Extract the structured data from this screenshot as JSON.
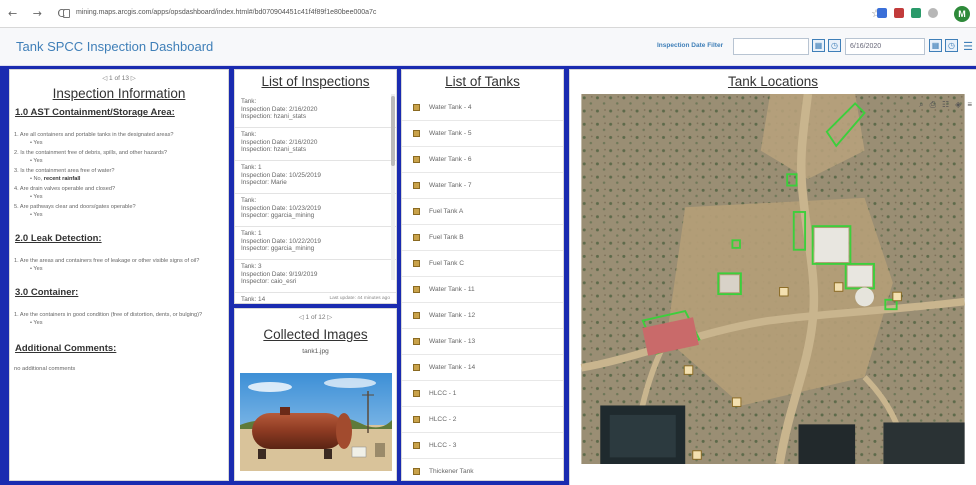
{
  "browser": {
    "nav": "← → C",
    "url": "mining.maps.arcgis.com/apps/opsdashboard/index.html#/bd070904451c41f4f89f1e80bee000a7c",
    "avatar": "M"
  },
  "header": {
    "title": "Tank SPCC Inspection Dashboard",
    "filter_label": "Inspection Date Filter",
    "date_to": "6/16/2020"
  },
  "info_panel": {
    "pager": "◁   1 of 13   ▷",
    "heading": "Inspection Information",
    "sections": [
      {
        "title": "1.0 AST Containment/Storage Area:",
        "items": [
          {
            "q": "1. Are all containers and portable tanks in the designated areas?",
            "a": "Yes"
          },
          {
            "q": "2. Is the containment free of debris, spills, and other hazards?",
            "a": "Yes"
          },
          {
            "q": "3. Is the containment area free of water?",
            "a": "No,",
            "a_bold": "recent rainfall"
          },
          {
            "q": "4. Are drain valves operable and closed?",
            "a": "Yes"
          },
          {
            "q": "5. Are pathways clear and doors/gates operable?",
            "a": "Yes"
          }
        ]
      },
      {
        "title": "2.0 Leak Detection:",
        "items": [
          {
            "q": "1. Are the areas and containers free of leakage or other visible signs of oil?",
            "a": "Yes"
          }
        ]
      },
      {
        "title": "3.0 Container:",
        "items": [
          {
            "q": "1. Are the containers in good condition (free of distortion, dents, or bulging)?",
            "a": "Yes"
          }
        ]
      }
    ],
    "comments_title": "Additional Comments:",
    "comments": "no additional comments"
  },
  "inspections_panel": {
    "heading": "List of Inspections",
    "items": [
      {
        "tank": "Tank:",
        "date": "Inspection Date: 2/16/2020",
        "inspector": "Inspection: hzani_stats"
      },
      {
        "tank": "Tank:",
        "date": "Inspection Date: 2/16/2020",
        "inspector": "Inspection: hzani_stats"
      },
      {
        "tank": "Tank: 1",
        "date": "Inspection Date: 10/25/2019",
        "inspector": "Inspector: Marie"
      },
      {
        "tank": "Tank:",
        "date": "Inspection Date: 10/23/2019",
        "inspector": "Inspector: ggarcia_mining"
      },
      {
        "tank": "Tank: 1",
        "date": "Inspection Date: 10/22/2019",
        "inspector": "Inspector: ggarcia_mining"
      },
      {
        "tank": "Tank: 3",
        "date": "Inspection Date: 9/19/2019",
        "inspector": "Inspector: caio_esri"
      },
      {
        "tank": "Tank: 14",
        "date": "",
        "inspector": ""
      }
    ],
    "last_update": "Last update: 44 minutes ago"
  },
  "images_panel": {
    "pager": "◁   1 of 12   ▷",
    "heading": "Collected Images",
    "filename": "tank1.jpg"
  },
  "tanks_panel": {
    "heading": "List of Tanks",
    "items": [
      "Water Tank - 4",
      "Water Tank - 5",
      "Water Tank - 6",
      "Water Tank - 7",
      "Fuel Tank A",
      "Fuel Tank B",
      "Fuel Tank C",
      "Water Tank - 11",
      "Water Tank - 12",
      "Water Tank - 13",
      "Water Tank - 14",
      "HLCC - 1",
      "HLCC - 2",
      "HLCC - 3",
      "Thickener Tank"
    ]
  },
  "map_panel": {
    "heading": "Tank Locations"
  },
  "colors": {
    "accent": "#3f7fb8",
    "slide_background": "#1a2bb0",
    "map_outline": "#3ccf3c"
  }
}
